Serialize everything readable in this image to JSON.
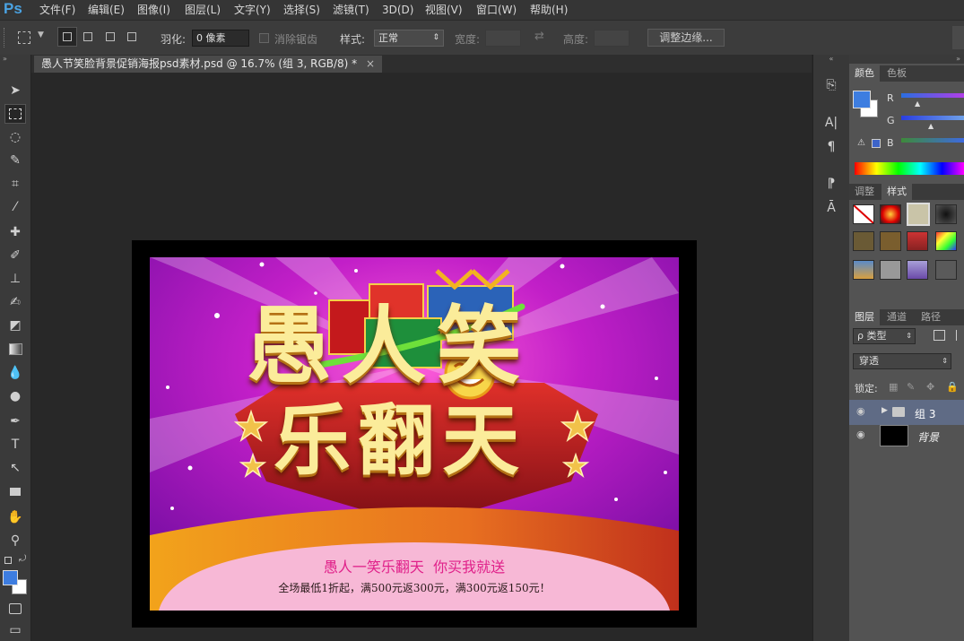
{
  "app": {
    "logo": "Ps"
  },
  "menu": [
    "文件(F)",
    "编辑(E)",
    "图像(I)",
    "图层(L)",
    "文字(Y)",
    "选择(S)",
    "滤镜(T)",
    "3D(D)",
    "视图(V)",
    "窗口(W)",
    "帮助(H)"
  ],
  "options": {
    "feather_label": "羽化:",
    "feather_value": "0 像素",
    "antialias_label": "消除锯齿",
    "style_label": "样式:",
    "style_value": "正常",
    "width_label": "宽度:",
    "height_label": "高度:",
    "refine_edge_button": "调整边缘..."
  },
  "document": {
    "tab_title": "愚人节笑脸背景促销海报psd素材.psd @ 16.7% (组 3, RGB/8) *",
    "close_glyph": "×"
  },
  "poster": {
    "title_line1": "愚人笑",
    "title_line2": "乐翻天",
    "slogan": "愚人一笑乐翻天  你买我就送",
    "promo": "全场最低1折起，满500元返300元，满300元返150元！"
  },
  "panels": {
    "color_tabs": [
      "颜色",
      "色板"
    ],
    "channels": [
      "R",
      "G",
      "B"
    ],
    "style_tabs": [
      "调整",
      "样式"
    ],
    "layers_tabs": [
      "图层",
      "通道",
      "路径"
    ],
    "filter_kind": "ρ 类型",
    "blend_mode": "穿透",
    "lock_label": "锁定:",
    "layers": [
      {
        "name": "组 3",
        "type": "group"
      },
      {
        "name": "背景",
        "type": "background"
      }
    ]
  },
  "colors": {
    "foreground": "#3d7de0",
    "background": "#ffffff",
    "accent_blue": "#4aa3e3"
  }
}
